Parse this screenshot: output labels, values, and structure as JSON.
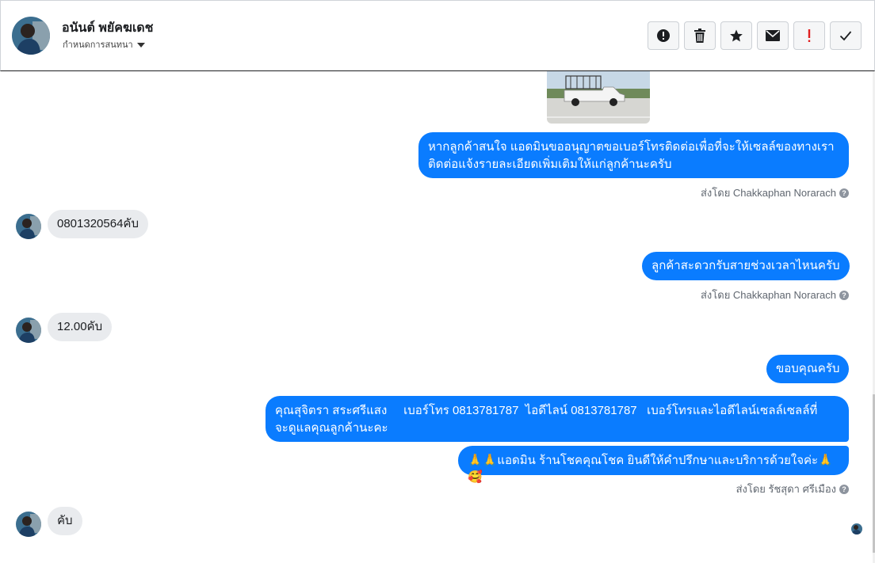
{
  "header": {
    "contact_name": "อนันต์ พยัคฆเดช",
    "assign_label": "กำหนดการสนทนา",
    "actions": [
      {
        "name": "report-spam-button",
        "icon": "exclamation-circle-icon"
      },
      {
        "name": "delete-button",
        "icon": "trash-icon"
      },
      {
        "name": "star-button",
        "icon": "star-icon"
      },
      {
        "name": "mark-unread-button",
        "icon": "envelope-icon"
      },
      {
        "name": "follow-up-button",
        "icon": "exclamation-icon"
      },
      {
        "name": "mark-done-button",
        "icon": "check-icon"
      }
    ]
  },
  "messages": {
    "out1": "หากลูกค้าสนใจ แอดมินขออนุญาตขอเบอร์โทรติดต่อเพื่อที่จะให้เซลล์ของทางเรา\nติดต่อแจ้งรายละเอียดเพิ่มเติมให้แก่ลูกค้านะครับ",
    "sent1": "ส่งโดย Chakkaphan Norarach",
    "in1": "0801320564คับ",
    "out2": "ลูกค้าสะดวกรับสายช่วงเวลาไหนครับ",
    "sent2": "ส่งโดย Chakkaphan Norarach",
    "in2": "12.00คับ",
    "out3": "ขอบคุณครับ",
    "out4": "คุณสุจิตรา สระศรีแสง     เบอร์โทร 0813781787  ไอดีไลน์ 0813781787   เบอร์โทรและไอดีไลน์เซลล์เซลล์ที่\nจะดูแลคุณลูกค้านะคะ",
    "out5": "🙏🙏แอดมิน ร้านโชคคุณโชค ยินดีให้คำปรึกษาและบริการด้วยใจค่ะ🙏🥰",
    "sent3": "ส่งโดย รัชสุดา ศรีเมือง",
    "in3": "คับ"
  },
  "colors": {
    "outgoing_bubble": "#0a7cff",
    "incoming_bubble": "#e9ebee",
    "sent_by_text": "#606770"
  }
}
